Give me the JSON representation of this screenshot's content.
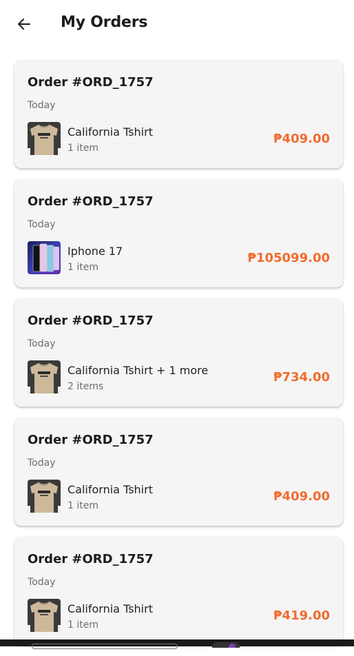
{
  "header": {
    "title": "My Orders",
    "back_icon": "arrow-left-icon"
  },
  "colors": {
    "price": "#f26b2d",
    "card_bg": "#f5f5f5"
  },
  "orders": [
    {
      "id_label": "Order #ORD_1757",
      "date": "Today",
      "item_name": "California Tshirt",
      "item_count": "1 item",
      "price": "₱409.00",
      "thumb": "tshirt"
    },
    {
      "id_label": "Order #ORD_1757",
      "date": "Today",
      "item_name": "Iphone 17",
      "item_count": "1 item",
      "price": "₱105099.00",
      "thumb": "phone"
    },
    {
      "id_label": "Order #ORD_1757",
      "date": "Today",
      "item_name": "California Tshirt + 1 more",
      "item_count": "2 items",
      "price": "₱734.00",
      "thumb": "tshirt"
    },
    {
      "id_label": "Order #ORD_1757",
      "date": "Today",
      "item_name": "California Tshirt",
      "item_count": "1 item",
      "price": "₱409.00",
      "thumb": "tshirt"
    },
    {
      "id_label": "Order #ORD_1757",
      "date": "Today",
      "item_name": "California Tshirt",
      "item_count": "1 item",
      "price": "₱419.00",
      "thumb": "tshirt"
    }
  ]
}
